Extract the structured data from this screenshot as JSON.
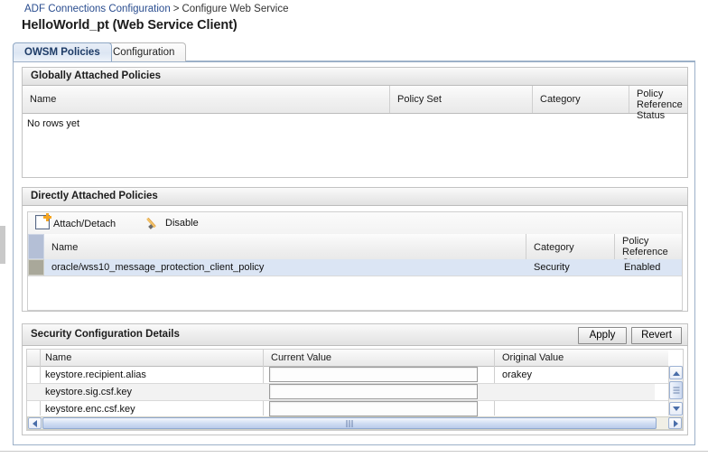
{
  "breadcrumb": {
    "parent": "ADF Connections Configuration",
    "separator": ">",
    "current": "Configure Web Service"
  },
  "page_title": "HelloWorld_pt (Web Service Client)",
  "tabs": [
    {
      "label": "OWSM Policies",
      "active": true
    },
    {
      "label": "Configuration",
      "active": false
    }
  ],
  "sections": {
    "globally_attached": {
      "title": "Globally Attached Policies",
      "columns": [
        "Name",
        "Policy Set",
        "Category",
        "Policy Reference Status"
      ],
      "empty_text": "No rows yet",
      "rows": []
    },
    "directly_attached": {
      "title": "Directly Attached Policies",
      "toolbar": [
        {
          "label": "Attach/Detach",
          "icon": "document-plus-icon"
        },
        {
          "label": "Disable",
          "icon": "pencil-icon"
        }
      ],
      "columns": [
        "Name",
        "Category",
        "Policy Reference Status"
      ],
      "rows": [
        {
          "name": "oracle/wss10_message_protection_client_policy",
          "category": "Security",
          "status": "Enabled",
          "selected": true
        }
      ]
    },
    "security_config": {
      "title": "Security Configuration Details",
      "buttons": {
        "apply": "Apply",
        "revert": "Revert"
      },
      "columns": [
        "Name",
        "Current Value",
        "Original Value"
      ],
      "rows": [
        {
          "name": "keystore.recipient.alias",
          "current_value": "",
          "original_value": "orakey"
        },
        {
          "name": "keystore.sig.csf.key",
          "current_value": "",
          "original_value": ""
        },
        {
          "name": "keystore.enc.csf.key",
          "current_value": "",
          "original_value": ""
        }
      ]
    }
  },
  "colors": {
    "link": "#2a4d8f",
    "tab_active_text": "#1d3b66",
    "panel_border": "#9cb0c8",
    "selected_row": "#dbe5f4",
    "scrollbar_accent": "#4a6ea9"
  }
}
